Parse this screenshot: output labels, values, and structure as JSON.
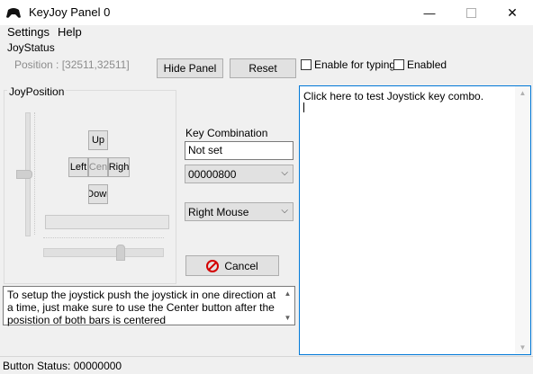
{
  "window": {
    "title": "KeyJoy Panel 0",
    "minimize": "—",
    "close": "✕"
  },
  "menu": {
    "items": [
      "Settings",
      "Help"
    ]
  },
  "joystatus": {
    "label": "JoyStatus",
    "position": "Position : [32511,32511]",
    "hide_panel": "Hide Panel",
    "reset": "Reset",
    "enable_typing": "Enable for typing",
    "enabled": "Enabled"
  },
  "joyposition": {
    "label": "JoyPosition",
    "up": "Up",
    "left": "Left",
    "center": "Cen",
    "right": "Righ",
    "down": "Dowr",
    "vertical_slider_level": 0.5,
    "horizontal_slider_level": 0.5
  },
  "keycombo": {
    "label": "Key Combination",
    "value": "Not set",
    "code_select": "00000800",
    "mouse_select": "Right Mouse",
    "cancel": "Cancel"
  },
  "help_text": "To setup the joystick push the joystick in one direction at a time, just make sure to use the Center button after the posistion of both bars is centered",
  "test_area": {
    "text": "Click here to test Joystick key combo."
  },
  "status": {
    "text": "Button Status: 00000000"
  },
  "colors": {
    "cancel_icon": "#d40000",
    "focus_border": "#0078d7"
  }
}
